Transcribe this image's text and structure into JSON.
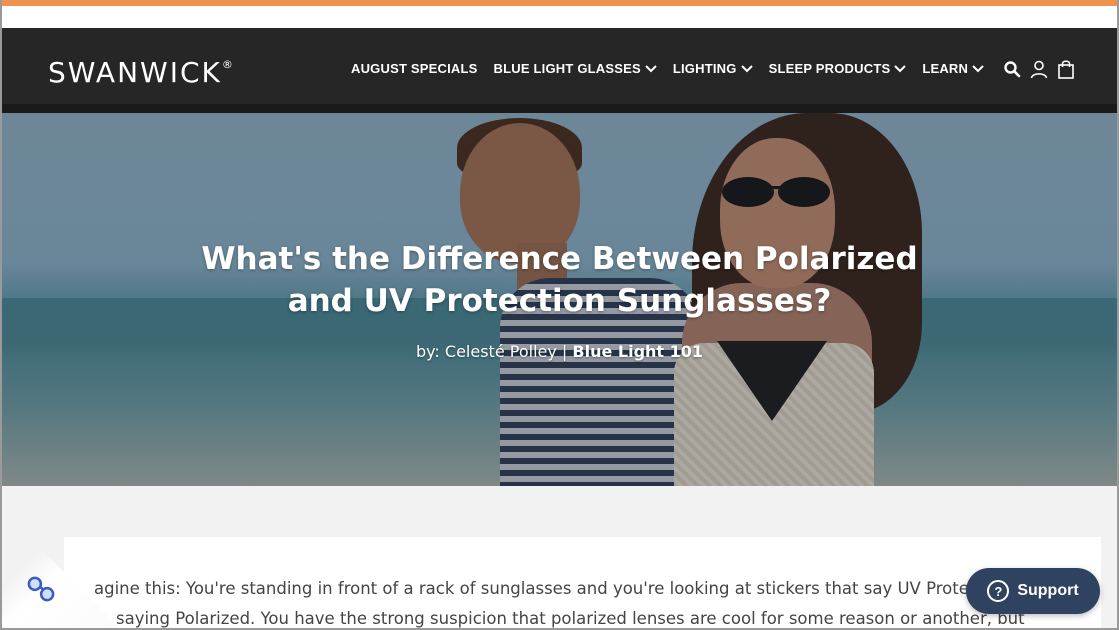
{
  "brand": {
    "name": "SWANWICK",
    "mark": "®"
  },
  "nav": {
    "items": [
      {
        "label": "AUGUST SPECIALS",
        "has_dropdown": false
      },
      {
        "label": "BLUE LIGHT GLASSES",
        "has_dropdown": true
      },
      {
        "label": "LIGHTING",
        "has_dropdown": true
      },
      {
        "label": "SLEEP PRODUCTS",
        "has_dropdown": true
      },
      {
        "label": "LEARN",
        "has_dropdown": true
      }
    ],
    "icons": [
      "search-icon",
      "account-icon",
      "cart-icon"
    ]
  },
  "hero": {
    "title_line1": "What's the Difference Between Polarized",
    "title_line2": "and UV Protection Sunglasses?",
    "byline_prefix": "by: Celesté Polley | ",
    "byline_category": "Blue Light 101"
  },
  "article": {
    "line1": "agine this: You're standing in front of a rack of sunglasses and you're looking at stickers that say UV Prote",
    "line2": "saying Polarized. You have the strong suspicion that polarized lenses are cool for some reason or another, but"
  },
  "support": {
    "label": "Support"
  },
  "colors": {
    "accent": "#f0924f",
    "navbar": "#262626",
    "support_button": "#2f4260"
  }
}
